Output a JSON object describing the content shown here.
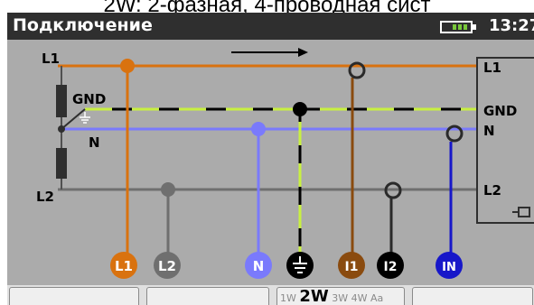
{
  "top_caption": "2W: 2-фазная, 4-проводная сист",
  "header": {
    "title": "Подключение",
    "time": "13:27",
    "battery_icon": "battery-icon"
  },
  "diagram": {
    "left_labels": [
      "L1",
      "GND",
      "N",
      "L2"
    ],
    "right_labels": [
      "L1",
      "GND",
      "N",
      "L2"
    ],
    "bottom_terminals": [
      "L1",
      "L2",
      "N",
      "ground-symbol",
      "I1",
      "I2",
      "IN"
    ],
    "colors": {
      "L1": "#d9720f",
      "L2": "#6f6f6f",
      "N": "#7a7afc",
      "GND_dash": "#c8f040",
      "IN": "#1717c9",
      "I1": "#8a4b0f",
      "black": "#000000"
    }
  },
  "softkeys": {
    "modes": [
      {
        "label": "1W",
        "selected": false
      },
      {
        "label": "2W",
        "selected": true
      },
      {
        "label": "3W",
        "selected": false
      },
      {
        "label": "4W",
        "selected": false
      },
      {
        "label": "Aa",
        "selected": false
      }
    ]
  }
}
